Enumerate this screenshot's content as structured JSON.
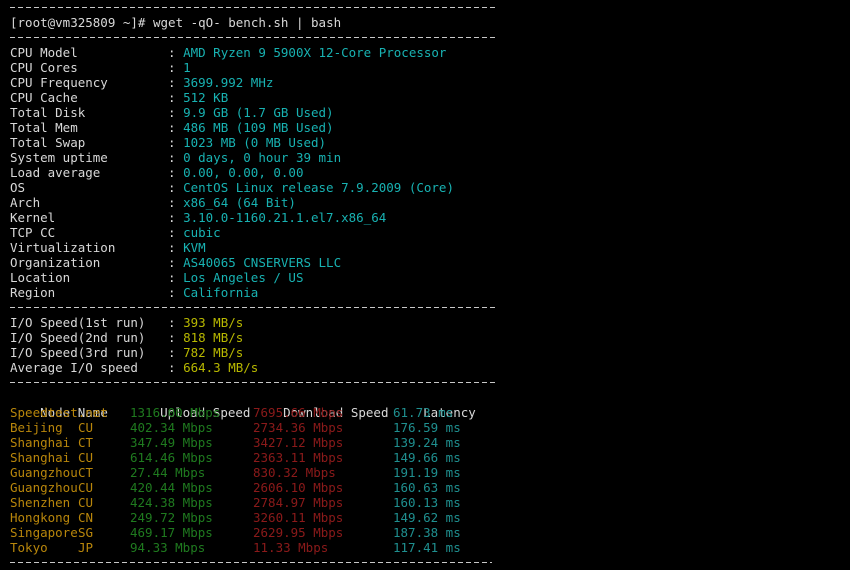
{
  "terminal": {
    "prompt": "[root@vm325809 ~]# wget -qO- bench.sh | bash",
    "colors": {
      "background": "#000000",
      "default_text": "#d8d8d8",
      "value_cyan": "#18b2b2",
      "io_yellow": "#b8b800",
      "node_yellow": "#b8860b",
      "upload_green": "#1f7a1f",
      "download_red": "#8b1a1a",
      "latency_cyan": "#1f8f8f",
      "rule_gray": "#c8c8c8"
    }
  },
  "sysinfo": [
    {
      "label": "CPU Model",
      "value": "AMD Ryzen 9 5900X 12-Core Processor"
    },
    {
      "label": "CPU Cores",
      "value": "1"
    },
    {
      "label": "CPU Frequency",
      "value": "3699.992 MHz"
    },
    {
      "label": "CPU Cache",
      "value": "512 KB"
    },
    {
      "label": "Total Disk",
      "value": "9.9 GB (1.7 GB Used)"
    },
    {
      "label": "Total Mem",
      "value": "486 MB (109 MB Used)"
    },
    {
      "label": "Total Swap",
      "value": "1023 MB (0 MB Used)"
    },
    {
      "label": "System uptime",
      "value": "0 days, 0 hour 39 min"
    },
    {
      "label": "Load average",
      "value": "0.00, 0.00, 0.00"
    },
    {
      "label": "OS",
      "value": "CentOS Linux release 7.9.2009 (Core)"
    },
    {
      "label": "Arch",
      "value": "x86_64 (64 Bit)"
    },
    {
      "label": "Kernel",
      "value": "3.10.0-1160.21.1.el7.x86_64"
    },
    {
      "label": "TCP CC",
      "value": "cubic"
    },
    {
      "label": "Virtualization",
      "value": "KVM"
    },
    {
      "label": "Organization",
      "value": "AS40065 CNSERVERS LLC"
    },
    {
      "label": "Location",
      "value": "Los Angeles / US"
    },
    {
      "label": "Region",
      "value": "California"
    }
  ],
  "iospeed": [
    {
      "label": "I/O Speed(1st run)",
      "value": "393 MB/s"
    },
    {
      "label": "I/O Speed(2nd run)",
      "value": "818 MB/s"
    },
    {
      "label": "I/O Speed(3rd run)",
      "value": "782 MB/s"
    },
    {
      "label": "Average I/O speed",
      "value": "664.3 MB/s"
    }
  ],
  "speedtest": {
    "headers": {
      "node": "Node Name",
      "upload": "Upload Speed",
      "download": "Download Speed",
      "latency": "Latency"
    },
    "rows": [
      {
        "node": "Speedtest.net",
        "carrier": "",
        "upload": "1316.00 Mbps",
        "download": "7695.66 Mbps",
        "latency": "61.73 ms"
      },
      {
        "node": "Beijing",
        "carrier": "CU",
        "upload": "402.34 Mbps",
        "download": "2734.36 Mbps",
        "latency": "176.59 ms"
      },
      {
        "node": "Shanghai",
        "carrier": "CT",
        "upload": "347.49 Mbps",
        "download": "3427.12 Mbps",
        "latency": "139.24 ms"
      },
      {
        "node": "Shanghai",
        "carrier": "CU",
        "upload": "614.46 Mbps",
        "download": "2363.11 Mbps",
        "latency": "149.66 ms"
      },
      {
        "node": "Guangzhou",
        "carrier": "CT",
        "upload": "27.44 Mbps",
        "download": "830.32 Mbps",
        "latency": "191.19 ms"
      },
      {
        "node": "Guangzhou",
        "carrier": "CU",
        "upload": "420.44 Mbps",
        "download": "2606.10 Mbps",
        "latency": "160.63 ms"
      },
      {
        "node": "Shenzhen",
        "carrier": "CU",
        "upload": "424.38 Mbps",
        "download": "2784.97 Mbps",
        "latency": "160.13 ms"
      },
      {
        "node": "Hongkong",
        "carrier": "CN",
        "upload": "249.72 Mbps",
        "download": "3260.11 Mbps",
        "latency": "149.62 ms"
      },
      {
        "node": "Singapore",
        "carrier": "SG",
        "upload": "469.17 Mbps",
        "download": "2629.95 Mbps",
        "latency": "187.38 ms"
      },
      {
        "node": "Tokyo",
        "carrier": "JP",
        "upload": "94.33 Mbps",
        "download": "11.33 Mbps",
        "latency": "117.41 ms"
      }
    ]
  }
}
